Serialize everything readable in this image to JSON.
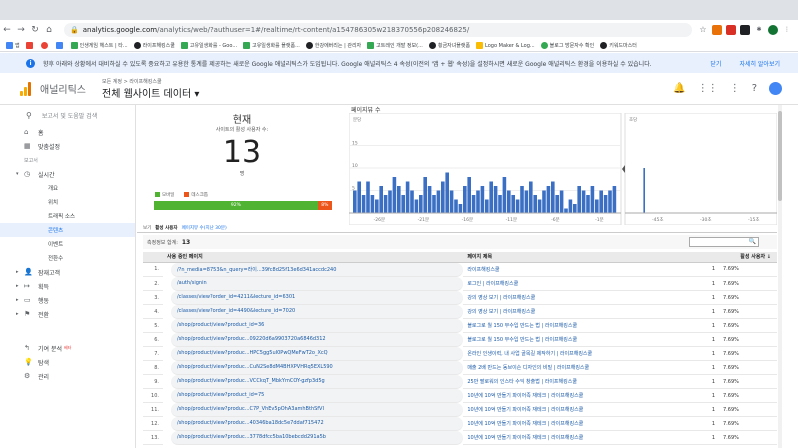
{
  "browser": {
    "url_host": "analytics.google.com",
    "url_path": "/analytics/web/?authuser=1#/realtime/rt-content/a154786305w218370556p208246825/",
    "bookmarks": [
      "앱",
      "",
      "",
      "",
      "인생게임 헤스트 | 타...",
      "라이프해킹스쿨",
      "고유일생화를 - Goo...",
      "고유일생화를 플랫폼...",
      "한강에버리는 | 관리자",
      "고트레인 개발 정보(...",
      "횡금자녀플랫폼",
      "Logo Maker & Log...",
      "블로그 방문자수 확인",
      "키워드마스터"
    ]
  },
  "banner": {
    "text": "향후 아래와 상황에서 대비하실 수 있도록 중요하고 유용한 통계를 제공하는 새로운 Google 애널리틱스가 도입됩니다. Google 애널리틱스 4 속성(이전의 '앱 + 웹' 속성)을 설정하시면 새로운 Google 애널리틱스 환경을 이용하실 수 있습니다.",
    "dismiss": "닫기",
    "learn_more": "자세히 알아보기"
  },
  "header": {
    "brand": "애널리틱스",
    "crumb": "모든 계정 > 라이프해킹스쿨",
    "property": "전체 웹사이트 데이터 ▾"
  },
  "sidebar": {
    "search_placeholder": "보고서 및 도움말 검색",
    "home": "홈",
    "custom": "맞춤설정",
    "reports_heading": "보고서",
    "realtime": "실시간",
    "overview": "개요",
    "location": "위치",
    "traffic": "트래픽 소스",
    "content": "콘텐츠",
    "events": "이벤트",
    "conversions": "전환수",
    "audience": "잠재고객",
    "acquisition": "획득",
    "behavior": "행동",
    "conv": "전환",
    "attribution": "기여 분석",
    "attribution_badge": "베타",
    "discover": "탐색",
    "admin": "관리"
  },
  "realtime": {
    "now_title": "현재",
    "now_sub": "사이트의 활성 사용자 수:",
    "now_value": "13",
    "now_unit": "명",
    "legend_mobile": "모바일",
    "legend_desktop": "데스크톱",
    "mobile_pct": "92%",
    "desktop_pct": "8%",
    "mobile_share": 0.92
  },
  "chart_data": {
    "type": "bar",
    "title": "페이지뷰 수",
    "panels": [
      {
        "label": "분당",
        "ylim": [
          0,
          20
        ],
        "y_ticks": [
          15,
          10,
          5
        ],
        "x_labels": [
          "-26분",
          "-21분",
          "-16분",
          "-11분",
          "-6분",
          "-1분"
        ],
        "values": [
          5,
          7,
          4,
          7,
          4,
          3,
          6,
          4,
          5,
          8,
          6,
          4,
          7,
          5,
          3,
          4,
          8,
          6,
          4,
          5,
          7,
          9,
          5,
          3,
          2,
          6,
          8,
          4,
          5,
          6,
          3,
          7,
          6,
          4,
          8,
          5,
          4,
          3,
          6,
          5,
          7,
          4,
          3,
          5,
          6,
          7,
          4,
          5,
          1,
          3,
          2,
          6,
          5,
          4,
          6,
          3,
          5,
          4,
          5,
          6
        ]
      },
      {
        "label": "초당",
        "ylim": [
          0,
          2
        ],
        "y_ticks": [],
        "x_labels": [
          "-45초",
          "-30초",
          "-15초"
        ],
        "values": [
          0,
          0,
          0,
          0,
          0,
          0,
          1,
          0,
          0,
          0,
          0,
          0,
          0,
          0,
          0,
          0,
          0,
          0,
          0,
          0,
          0,
          0,
          0,
          0,
          0,
          0,
          0,
          0,
          0,
          0,
          0,
          0,
          0,
          0,
          0,
          0,
          0,
          0,
          0,
          0,
          0,
          0,
          0,
          0,
          0,
          0,
          0,
          0,
          0,
          0,
          0,
          0,
          0,
          0,
          0,
          0,
          0,
          0,
          0,
          0
        ]
      }
    ]
  },
  "tabs": {
    "viewers": "보기",
    "active_users": "활성 사용자",
    "pageviews_link": "페이지뷰 수(지난 30분)"
  },
  "table_meta": {
    "active_label": "측정정보 합계:",
    "active_value": "13",
    "search_icon": "🔍"
  },
  "table": {
    "headers": [
      "사용 중인 페이지",
      "페이지 제목",
      "활성 사용자"
    ],
    "rows": [
      {
        "n": "1.",
        "url": "/?n_media=8753&n_query=라이...39fc8d25f13e6d341accdc240",
        "title": "라이프해킹스쿨",
        "count": "1",
        "pct": "7.69%"
      },
      {
        "n": "2.",
        "url": "/auth/signin",
        "title": "로그인 | 라이프해킹스쿨",
        "count": "1",
        "pct": "7.69%"
      },
      {
        "n": "3.",
        "url": "/classes/view?order_id=4211&lecture_id=6301",
        "title": "강의 영상 보기 | 라이프해킹스쿨",
        "count": "1",
        "pct": "7.69%"
      },
      {
        "n": "4.",
        "url": "/classes/view?order_id=4490&lecture_id=7020",
        "title": "강의 영상 보기 | 라이프해킹스쿨",
        "count": "1",
        "pct": "7.69%"
      },
      {
        "n": "5.",
        "url": "/shop/product/view?product_id=36",
        "title": "블로그로 월 150 부수입 만드는 법 | 라이프해킹스쿨",
        "count": "1",
        "pct": "7.69%"
      },
      {
        "n": "6.",
        "url": "/shop/product/view?produc...09220d6a9903720a6846d312",
        "title": "블로그로 월 150 부수입 만드는 법 | 라이프해킹스쿨",
        "count": "1",
        "pct": "7.69%"
      },
      {
        "n": "7.",
        "url": "/shop/product/view?produc...HPC5gg5uI0PwQMeFwT2o_XcQ",
        "title": "온라인 인생이력, 내 사업 골목길 제작하기 | 라이프해킹스쿨",
        "count": "1",
        "pct": "7.69%"
      },
      {
        "n": "8.",
        "url": "/shop/product/view?produc...CuN2Se8dM4BHXPVHRq5EXL590",
        "title": "매출 2배 만드는 동브이슨 디자인의 비밀 | 라이프해킹스쿨",
        "count": "1",
        "pct": "7.69%"
      },
      {
        "n": "9.",
        "url": "/shop/product/view?produc...VCCkqT_MbkYmCOY-gzfp3d5g",
        "title": "25만 팔로워의 인스타 수익 창출법 | 라이프해킹스쿨",
        "count": "1",
        "pct": "7.69%"
      },
      {
        "n": "10.",
        "url": "/shop/product/view?product_id=75",
        "title": "10년에 10억 만들기 파이어족 재테크 | 라이프해킹스쿨",
        "count": "1",
        "pct": "7.69%"
      },
      {
        "n": "11.",
        "url": "/shop/product/view?produc...C7P_VhEv5pOhA3amhBthSfVI",
        "title": "10년에 10억 만들기 파이어족 재테크 | 라이프해킹스쿨",
        "count": "1",
        "pct": "7.69%"
      },
      {
        "n": "12.",
        "url": "/shop/product/view?produc...40346ba18dc5e7ddaf715472",
        "title": "10년에 10억 만들기 파이어족 재테크 | 라이프해킹스쿨",
        "count": "1",
        "pct": "7.69%"
      },
      {
        "n": "13.",
        "url": "/shop/product/view?produc...3778dfcc5ba10bebcdd291a5b",
        "title": "10년에 10억 만들기 파이어족 재테크 | 라이프해킹스쿨",
        "count": "1",
        "pct": "7.69%"
      }
    ]
  }
}
